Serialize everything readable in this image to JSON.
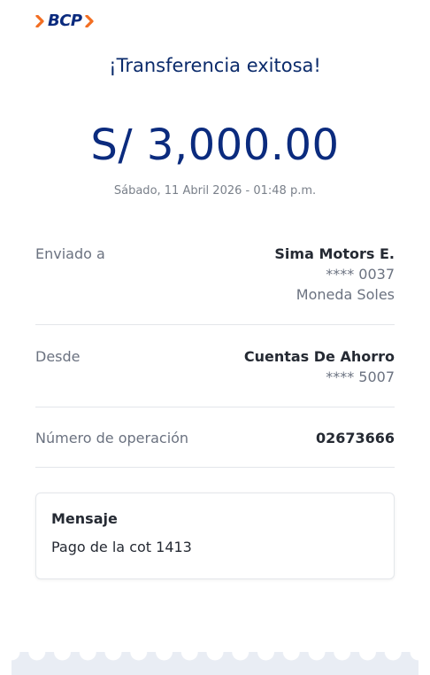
{
  "brand": {
    "logo_text": "BCP",
    "accent_color": "#f26e22",
    "primary_color": "#0b2b7e"
  },
  "header": {
    "title": "¡Transferencia exitosa!"
  },
  "transfer": {
    "amount": "S/ 3,000.00",
    "datetime": "Sábado, 11 Abril 2026 - 01:48 p.m."
  },
  "details": {
    "recipient": {
      "label": "Enviado a",
      "name": "Sima Motors E.",
      "account": "**** 0037",
      "currency": "Moneda Soles"
    },
    "source": {
      "label": "Desde",
      "account_type": "Cuentas De Ahorro",
      "account": "**** 5007"
    },
    "operation": {
      "label": "Número de operación",
      "number": "02673666"
    }
  },
  "message": {
    "title": "Mensaje",
    "text": "Pago de la cot 1413"
  },
  "icons": {
    "logo": "bcp-chevron-logo-icon",
    "receipt_edge": "scalloped-receipt-edge"
  }
}
